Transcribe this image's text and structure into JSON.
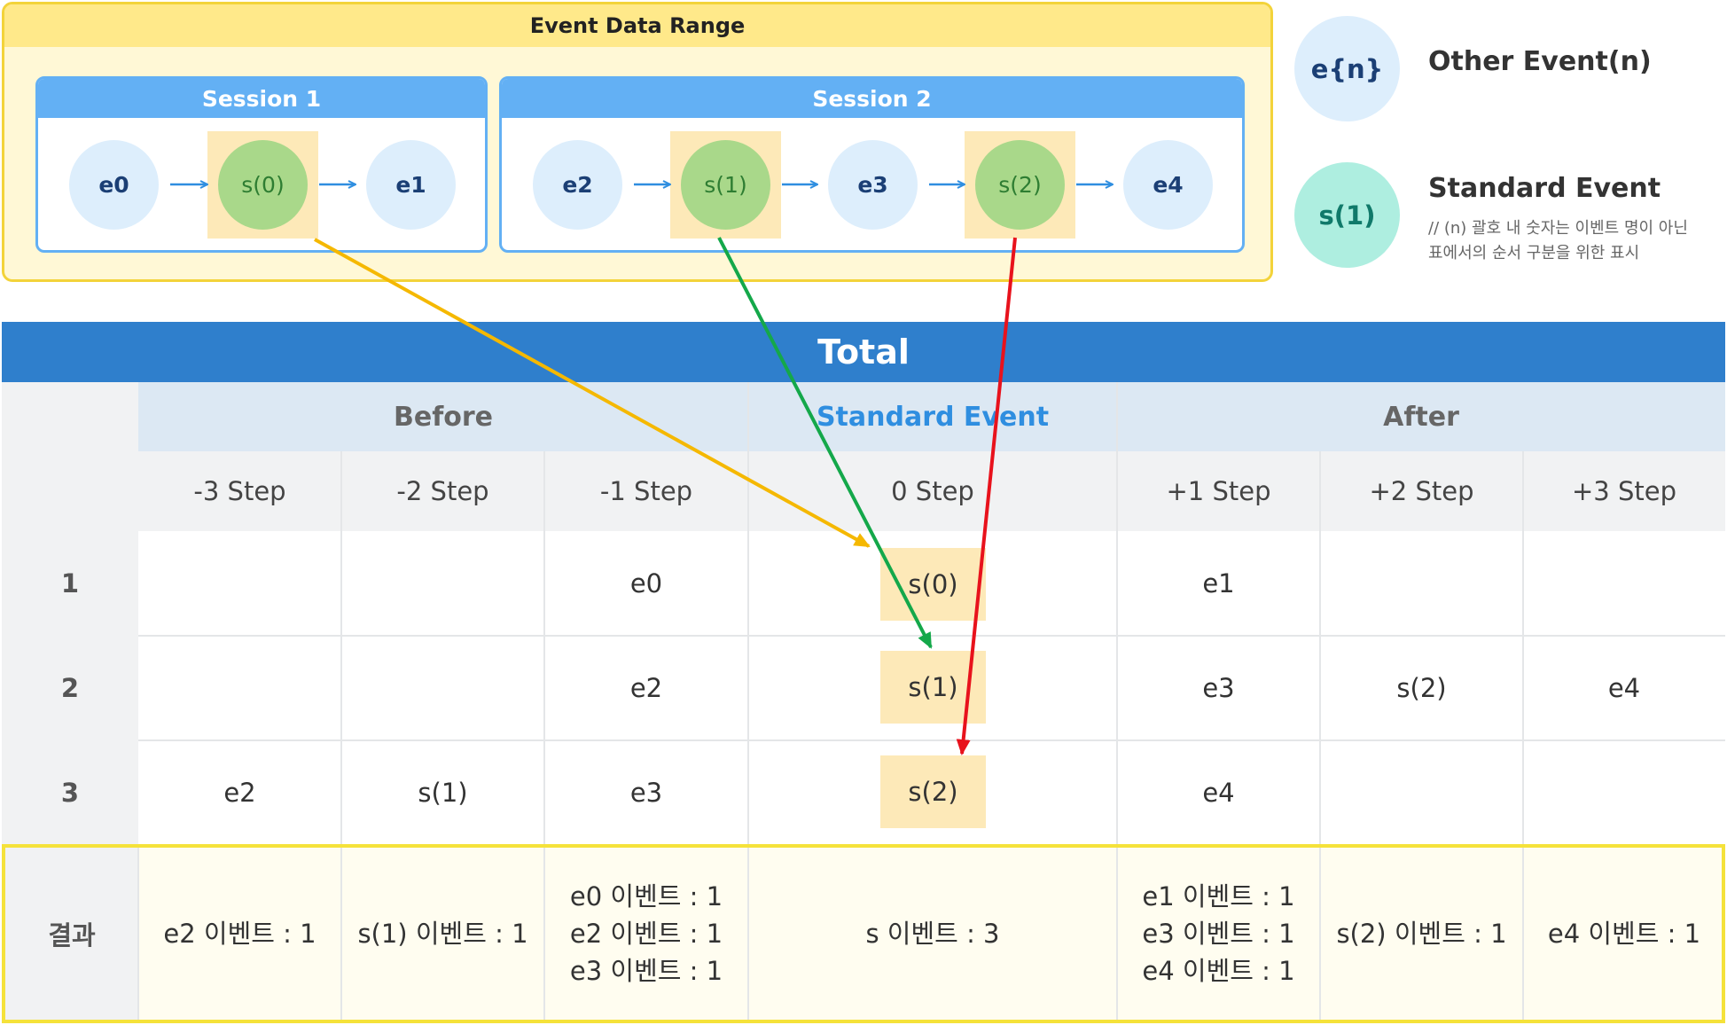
{
  "range": {
    "title": "Event Data Range",
    "sessions": [
      {
        "title": "Session 1",
        "events": [
          "e0",
          "s(0)",
          "e1"
        ]
      },
      {
        "title": "Session 2",
        "events": [
          "e2",
          "s(1)",
          "e3",
          "s(2)",
          "e4"
        ]
      }
    ]
  },
  "legend": {
    "other_symbol": "e{n}",
    "other_label": "Other Event(n)",
    "standard_symbol": "s(1)",
    "standard_label": "Standard Event",
    "note_line1": "// (n) 괄호 내 숫자는 이벤트 명이 아닌",
    "note_line2": "표에서의 순서 구분을 위한 표시"
  },
  "table": {
    "title": "Total",
    "groups": {
      "before": "Before",
      "standard": "Standard Event",
      "after": "After"
    },
    "steps": [
      "-3 Step",
      "-2 Step",
      "-1 Step",
      "0 Step",
      "+1 Step",
      "+2 Step",
      "+3 Step"
    ],
    "rows": [
      {
        "label": "1",
        "cells": [
          "",
          "",
          "e0",
          "s(0)",
          "e1",
          "",
          ""
        ]
      },
      {
        "label": "2",
        "cells": [
          "",
          "",
          "e2",
          "s(1)",
          "e3",
          "s(2)",
          "e4"
        ]
      },
      {
        "label": "3",
        "cells": [
          "e2",
          "s(1)",
          "e3",
          "s(2)",
          "e4",
          "",
          ""
        ]
      }
    ],
    "result": {
      "label": "결과",
      "cells": [
        [
          "e2 이벤트 : 1"
        ],
        [
          "s(1) 이벤트 : 1"
        ],
        [
          "e0 이벤트 : 1",
          "e2 이벤트 : 1",
          "e3 이벤트 : 1"
        ],
        [
          "s 이벤트 : 3"
        ],
        [
          "e1 이벤트 : 1",
          "e3 이벤트 : 1",
          "e4 이벤트 : 1"
        ],
        [
          "s(2) 이벤트 : 1"
        ],
        [
          "e4 이벤트 : 1"
        ]
      ]
    }
  },
  "colors": {
    "arrow_s0": "#f5b800",
    "arrow_s1": "#14a84a",
    "arrow_s2": "#e8121c",
    "accent_blue": "#2f7fcc",
    "standard_text": "#2f8ee0"
  }
}
